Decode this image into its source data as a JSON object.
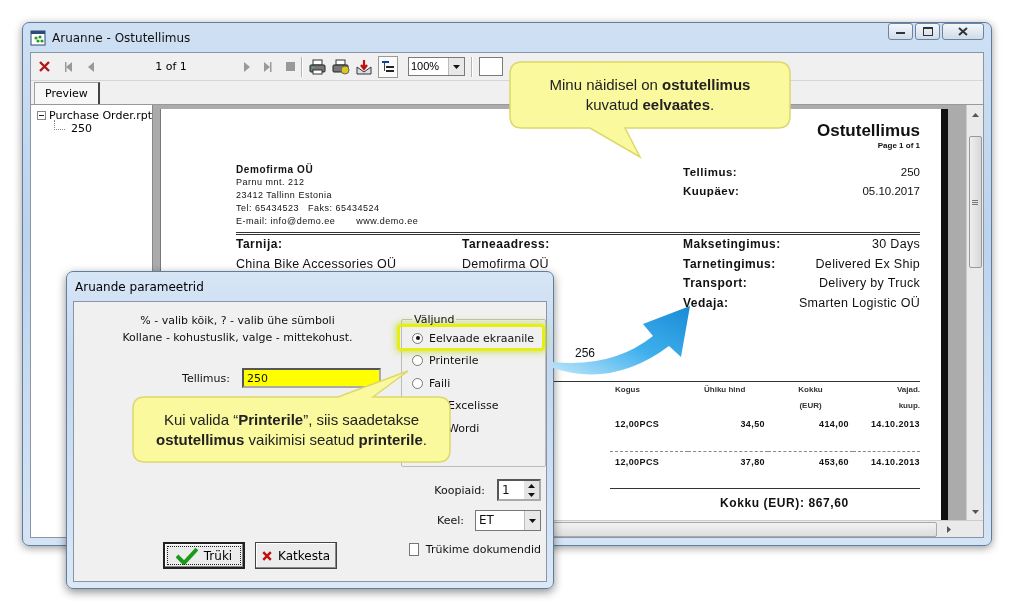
{
  "window": {
    "title": "Aruanne - Ostutellimus"
  },
  "toolbar": {
    "page_indicator": "1 of 1",
    "zoom": "100%"
  },
  "tabs": [
    {
      "label": "Preview",
      "selected": true
    }
  ],
  "tree": [
    {
      "label": "Purchase Order.rpt",
      "expanded": true,
      "children": [
        {
          "label": "250"
        }
      ]
    }
  ],
  "report": {
    "title": "Ostutellimus",
    "page": "Page 1 of 1",
    "company": {
      "name": "Demofirma OÜ",
      "lines": [
        "Parnu mnt. 212",
        "23412 Tallinn Estonia",
        "Tel: 65434523   Faks: 65434524",
        "E-mail: info@demo.ee       www.demo.ee"
      ]
    },
    "order_fields": [
      {
        "label": "Tellimus:",
        "value": "250"
      },
      {
        "label": "Kuupäev:",
        "value": "05.10.2017"
      }
    ],
    "supplier": {
      "label": "Tarnija:",
      "value": "China Bike Accessories OÜ"
    },
    "delivery_address": {
      "label": "Tarneaadress:",
      "value": "Demofirma OÜ"
    },
    "terms": [
      {
        "label": "Maksetingimus:",
        "value": "30 Days"
      },
      {
        "label": "Tarnetingimus:",
        "value": "Delivered Ex Ship"
      },
      {
        "label": "Transport:",
        "value": "Delivery by Truck"
      },
      {
        "label": "Vedaja:",
        "value": "Smarten Logistic OÜ"
      }
    ],
    "fragment": "256",
    "table": {
      "columns": [
        "Kogus",
        "Ühiku hind",
        "Kokku (EUR)",
        "Vajad. kuup."
      ],
      "rows": [
        [
          "12,00PCS",
          "34,50",
          "414,00",
          "14.10.2013"
        ],
        [
          "12,00PCS",
          "37,80",
          "453,60",
          "14.10.2013"
        ]
      ]
    },
    "total": "Kokku (EUR): 867,60"
  },
  "dialog": {
    "title": "Aruande parameetrid",
    "hints": [
      "% - valib kõik, ? - valib ühe sümboli",
      "Kollane - kohustuslik, valge - mittekohust."
    ],
    "order_field": {
      "label": "Tellimus:",
      "value": "250",
      "required": true
    },
    "output": {
      "label": "Väljund",
      "options": [
        {
          "label": "Eelvaade ekraanile",
          "selected": true,
          "highlighted": true
        },
        {
          "label": "Printerile",
          "selected": false
        },
        {
          "label": "Faili",
          "selected": false
        }
      ],
      "covered_options": [
        "Excelisse",
        "Wordi"
      ]
    },
    "copies": {
      "label": "Koopiaid:",
      "value": "1"
    },
    "language": {
      "label": "Keel:",
      "value": "ET"
    },
    "print_documents": {
      "label": "Trükime dokumendid",
      "checked": false
    },
    "buttons": [
      {
        "kind": "ok",
        "label": "Trüki",
        "default": true
      },
      {
        "kind": "cancel",
        "label": "Katkesta",
        "default": false
      }
    ]
  },
  "callouts": [
    {
      "text": "Minu näidisel on **ostutellimus** kuvatud **eelvaates**."
    },
    {
      "text": "Kui valida “**Printerile**”, siis saadetakse **ostutellimus** vaikimisi seatud **printerile**."
    }
  ]
}
